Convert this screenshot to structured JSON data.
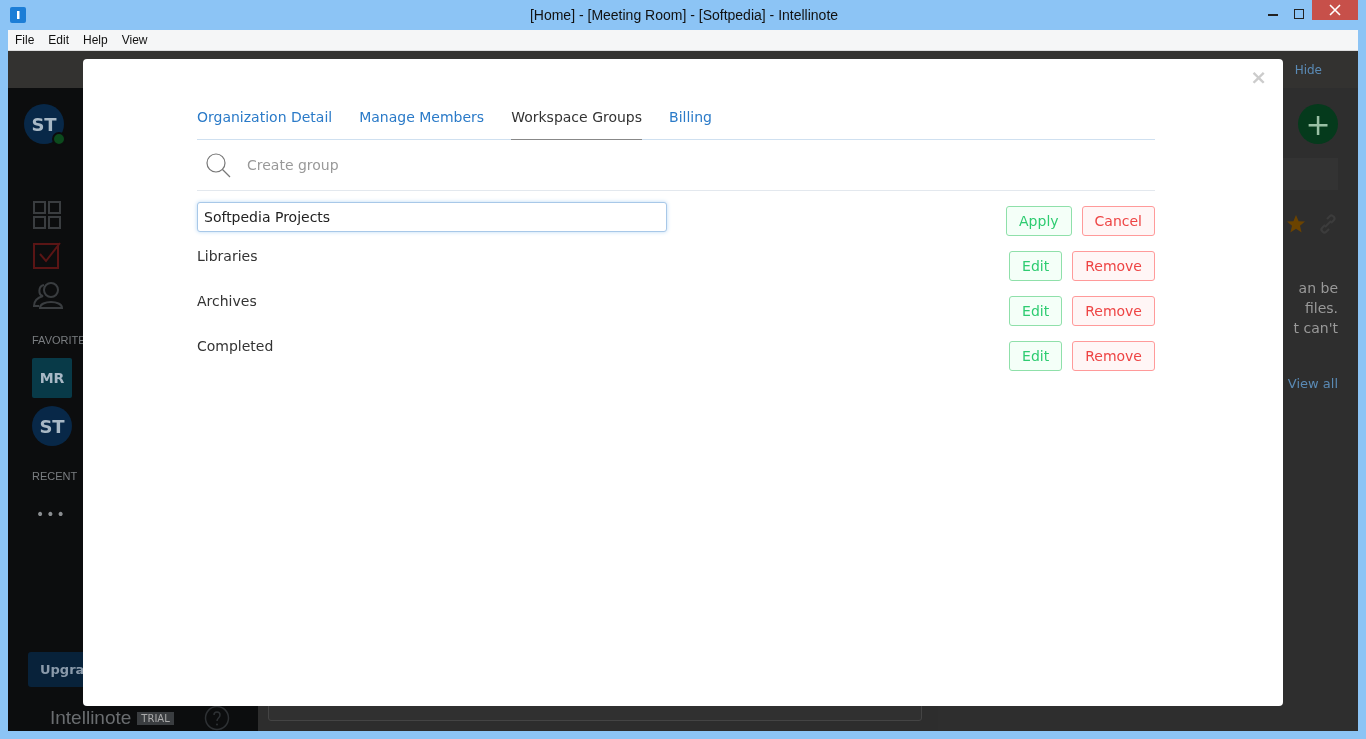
{
  "window": {
    "title": "[Home] - [Meeting Room] - [Softpedia] - Intellinote"
  },
  "menu": [
    "File",
    "Edit",
    "Help",
    "View"
  ],
  "sidebar": {
    "user": {
      "initials": "ST",
      "online": true
    },
    "favorites_label": "FAVORITE",
    "favorites": [
      {
        "initials": "MR",
        "kind": "square"
      },
      {
        "initials": "ST",
        "kind": "circle"
      }
    ],
    "recent_label": "RECENT",
    "recent_more": "•••",
    "upgrade": "Upgra",
    "brand": "Intellinote",
    "badge": "TRIAL"
  },
  "right_panel": {
    "hide": "Hide",
    "add": "+",
    "lines": [
      "an be",
      "files.",
      "t can't"
    ],
    "view_all": "View all"
  },
  "dialog": {
    "close": "×",
    "tabs": [
      {
        "label": "Organization Detail",
        "selected": false
      },
      {
        "label": "Manage Members",
        "selected": false
      },
      {
        "label": "Workspace Groups",
        "selected": true
      },
      {
        "label": "Billing",
        "selected": false
      }
    ],
    "search": {
      "placeholder": "Create group"
    },
    "editing": {
      "value": "Softpedia Projects",
      "actions": [
        {
          "label": "Apply",
          "kind": "positive"
        },
        {
          "label": "Cancel",
          "kind": "negative"
        }
      ]
    },
    "groups": [
      {
        "name": "Libraries",
        "actions": [
          {
            "label": "Edit",
            "kind": "positive"
          },
          {
            "label": "Remove",
            "kind": "negative"
          }
        ]
      },
      {
        "name": "Archives",
        "actions": [
          {
            "label": "Edit",
            "kind": "positive"
          },
          {
            "label": "Remove",
            "kind": "negative"
          }
        ]
      },
      {
        "name": "Completed",
        "actions": [
          {
            "label": "Edit",
            "kind": "positive"
          },
          {
            "label": "Remove",
            "kind": "negative"
          }
        ]
      }
    ]
  }
}
